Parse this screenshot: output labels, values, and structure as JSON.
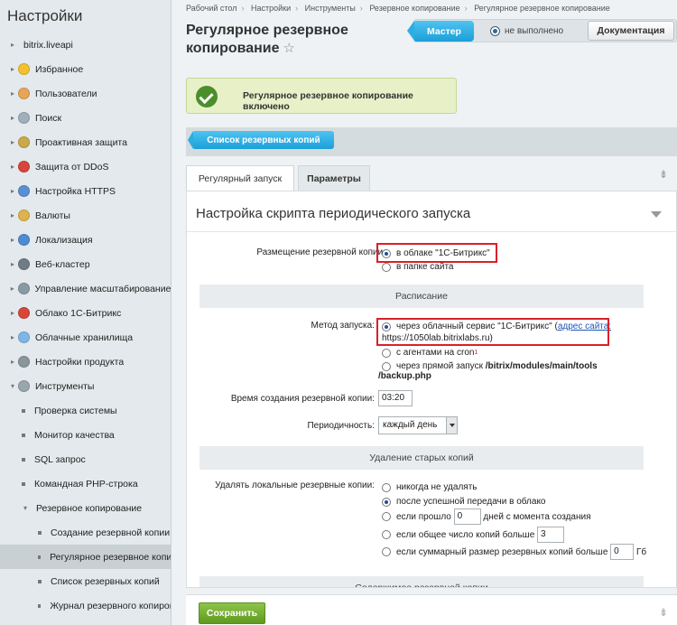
{
  "sidebar": {
    "title": "Настройки",
    "items": [
      {
        "label": "bitrix.liveapi",
        "kind": "arrow",
        "arrow": "▸"
      },
      {
        "label": "Избранное",
        "kind": "icon",
        "arrow": "▸",
        "color": "#f2c12e"
      },
      {
        "label": "Пользователи",
        "kind": "icon",
        "arrow": "▸",
        "color": "#e8a55a"
      },
      {
        "label": "Поиск",
        "kind": "icon",
        "arrow": "▸",
        "color": "#9fb0bb"
      },
      {
        "label": "Проактивная защита",
        "kind": "icon",
        "arrow": "▸",
        "color": "#caa94a"
      },
      {
        "label": "Защита от DDoS",
        "kind": "icon",
        "arrow": "▸",
        "color": "#d8453a"
      },
      {
        "label": "Настройка HTTPS",
        "kind": "icon",
        "arrow": "▸",
        "color": "#5b8fd4"
      },
      {
        "label": "Валюты",
        "kind": "icon",
        "arrow": "▸",
        "color": "#e0b24b"
      },
      {
        "label": "Локализация",
        "kind": "icon",
        "arrow": "▸",
        "color": "#4f8bd1"
      },
      {
        "label": "Веб-кластер",
        "kind": "icon",
        "arrow": "▸",
        "color": "#6f7c86"
      },
      {
        "label": "Управление масштабированием",
        "kind": "icon",
        "arrow": "▸",
        "color": "#8a9aa5"
      },
      {
        "label": "Облако 1С-Битрикс",
        "kind": "icon",
        "arrow": "▸",
        "color": "#d6473a"
      },
      {
        "label": "Облачные хранилища",
        "kind": "icon",
        "arrow": "▸",
        "color": "#7fb6e6"
      },
      {
        "label": "Настройки продукта",
        "kind": "icon",
        "arrow": "▸",
        "color": "#8a959c"
      },
      {
        "label": "Инструменты",
        "kind": "icon",
        "arrow": "▾",
        "color": "#9aa6ad"
      },
      {
        "label": "Проверка системы",
        "kind": "bullet",
        "indent": 1
      },
      {
        "label": "Монитор качества",
        "kind": "bullet",
        "indent": 1
      },
      {
        "label": "SQL запрос",
        "kind": "bullet",
        "indent": 1
      },
      {
        "label": "Командная PHP-строка",
        "kind": "bullet",
        "indent": 1
      },
      {
        "label": "Резервное копирование",
        "kind": "arrow",
        "indent": 1,
        "arrow": "▾"
      },
      {
        "label": "Создание резервной копии",
        "kind": "bullet",
        "indent": 2
      },
      {
        "label": "Регулярное резервное копирование",
        "kind": "bullet",
        "indent": 2,
        "active": true
      },
      {
        "label": "Список резервных копий",
        "kind": "bullet",
        "indent": 2
      },
      {
        "label": "Журнал резервного копирования",
        "kind": "bullet",
        "indent": 2
      }
    ]
  },
  "breadcrumb": [
    "Рабочий стол",
    "Настройки",
    "Инструменты",
    "Резервное копирование",
    "Регулярное резервное копирование"
  ],
  "page_title": "Регулярное резервное копирование",
  "star_glyph": "☆",
  "topbar": {
    "master_label": "Мастер",
    "status": "не выполнено",
    "docs_label": "Документация"
  },
  "notice": "Регулярное резервное копирование включено",
  "list_button": "Список резервных копий",
  "tabs": [
    "Регулярный запуск",
    "Параметры"
  ],
  "pin_glyph": "⇟",
  "panel": {
    "heading": "Настройка скрипта периодического запуска",
    "placement_label": "Размещение резервной копии:",
    "placement_options": [
      "в облаке \"1С-Битрикс\"",
      "в папке сайта"
    ],
    "schedule_title": "Расписание",
    "method_label": "Метод запуска:",
    "method_cloud_text": "через облачный сервис \"1С-Битрикс\" (",
    "method_cloud_link": "адрес сайта:",
    "method_cloud_url": "https://1050lab.bitrixlabs.ru)",
    "method_cron": "с агентами на cron",
    "method_cron_mark": "1",
    "method_direct_prefix": "через прямой запуск ",
    "method_direct_path1": "/bitrix/modules/main/tools",
    "method_direct_path2": "/backup.php",
    "time_label": "Время создания резервной копии:",
    "time_value": "03:20",
    "period_label": "Периодичность:",
    "period_value": "каждый день",
    "delete_title": "Удаление старых копий",
    "delete_label": "Удалять локальные резервные копии:",
    "delete_never": "никогда не удалять",
    "delete_after_upload": "после успешной передачи в облако",
    "delete_days_pre": "если прошло",
    "delete_days_value": "0",
    "delete_days_post": "дней с момента создания",
    "delete_count_pre": "если общее число копий больше",
    "delete_count_value": "3",
    "delete_size_pre": "если суммарный размер резервных копий больше",
    "delete_size_value": "0",
    "delete_size_unit": "Гб",
    "content_title": "Содержимое резервной копии"
  },
  "footer": {
    "save_label": "Сохранить"
  },
  "colors": {
    "accent": "#1b9fd9",
    "save": "#5f9a1f",
    "highlight": "#d9202a"
  }
}
